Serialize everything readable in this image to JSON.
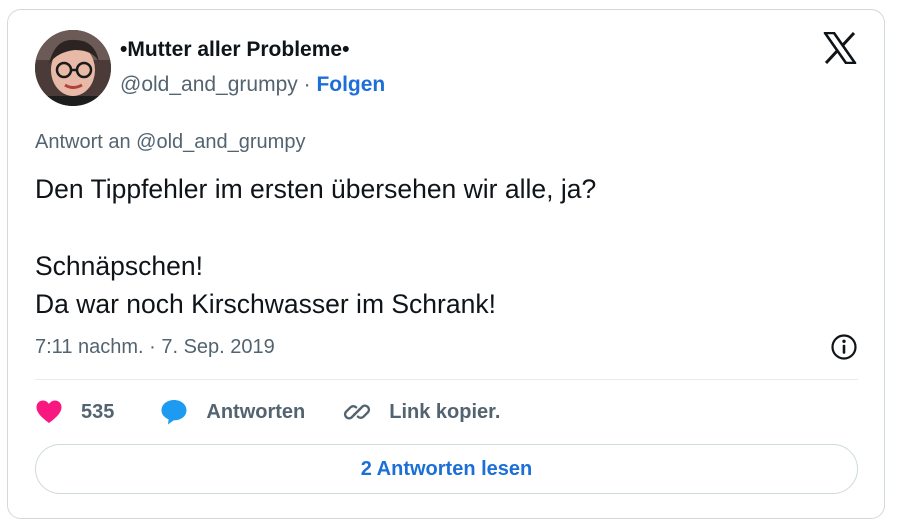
{
  "author": {
    "display_name": "•Mutter aller Probleme•",
    "handle": "@old_and_grumpy",
    "separator": " · ",
    "follow_label": "Folgen"
  },
  "tweet": {
    "reply_to": "Antwort an @old_and_grumpy",
    "lines": [
      "Den Tippfehler im ersten übersehen wir alle, ja?",
      "Schnäpschen!",
      "Da war noch Kirschwasser im Schrank!"
    ],
    "timestamp": "7:11 nachm. · 7. Sep. 2019"
  },
  "actions": {
    "like_count": "535",
    "reply_label": "Antworten",
    "copy_link_label": "Link kopier."
  },
  "footer": {
    "read_replies_label": "2 Antworten lesen"
  },
  "icons": {
    "logo": "x-logo-icon",
    "info": "info-icon",
    "like": "heart-icon",
    "reply": "speech-bubble-icon",
    "link": "link-icon"
  },
  "colors": {
    "heart": "#f91880",
    "reply_bubble": "#1d9bf0",
    "accent_text": "#1d6fd8",
    "secondary_text": "#536471",
    "border": "#cfd9de"
  }
}
